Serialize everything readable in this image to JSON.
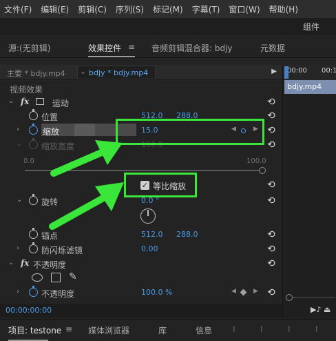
{
  "menu": [
    "文件(F)",
    "编辑(E)",
    "剪辑(C)",
    "序列(S)",
    "标记(M)",
    "字幕(T)",
    "窗口(W)",
    "帮助(H)"
  ],
  "workspace_label": "组件",
  "panel_tabs": {
    "source": "源:(无剪辑)",
    "effect_controls": "效果控件",
    "menu_glyph": "≡",
    "audio_mixer": "音频剪辑混合器: bdjy",
    "metadata": "元数据"
  },
  "sequence": {
    "master": "主要 * bdjy.mp4",
    "active": "bdjy * bdjy.mp4",
    "chevron": "⌄",
    "play": "▶"
  },
  "video_effects_heading": "视频效果",
  "motion": {
    "label": "运动",
    "position": {
      "label": "位置",
      "x": "512.0",
      "y": "288.0"
    },
    "scale": {
      "label": "缩放",
      "value": "15.0"
    },
    "scale_width": {
      "label": "缩放宽度",
      "value": "100.0"
    },
    "slider_min": "0.0",
    "slider_max": "100.0",
    "uniform_scale": {
      "label": "等比缩放",
      "checked": true
    },
    "rotation": {
      "label": "旋转",
      "value": "0.0 °"
    },
    "anchor": {
      "label": "锚点",
      "x": "512.0",
      "y": "288.0"
    },
    "anti_flicker": {
      "label": "防闪烁滤镜",
      "value": "0.00"
    }
  },
  "opacity": {
    "label": "不透明度",
    "value_label": "不透明度",
    "value": "100.0 %"
  },
  "fx_glyph": "fx",
  "reset_glyph": "⟲",
  "current_time": "00:00:00:00",
  "timeline": {
    "t0": "00:00",
    "t1": "00:1",
    "clip": "bdjy.mp4",
    "controls": "▶♪ ⏏"
  },
  "bottom_tabs": {
    "project": "项目: testone",
    "menu_glyph": "≡",
    "media_browser": "媒体浏览器",
    "library": "库",
    "info": "信息",
    "more": [
      "⁝",
      "⁝",
      "⁝",
      "⁝"
    ]
  },
  "colors": {
    "highlight": "#39e639",
    "value_blue": "#4a9be8",
    "panel_bg": "#232323"
  }
}
